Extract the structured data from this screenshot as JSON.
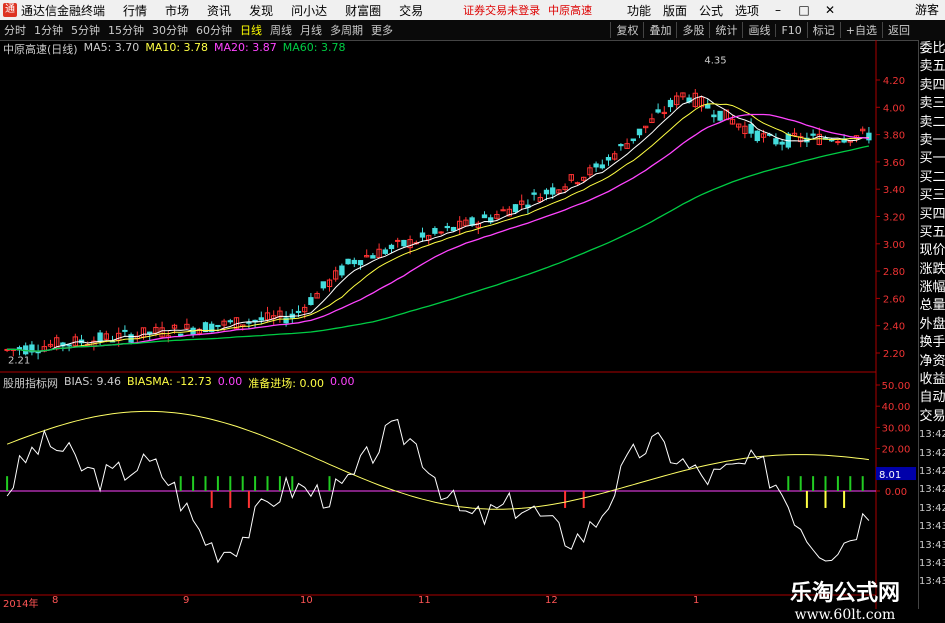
{
  "app": {
    "title": "通达信金融终端",
    "menu": [
      "行情",
      "市场",
      "资讯",
      "发现",
      "问小达",
      "财富圈",
      "交易"
    ],
    "notice": "证券交易未登录",
    "stock_name": "中原高速",
    "top_right": [
      "功能",
      "版面",
      "公式",
      "选项"
    ],
    "guest": "游客",
    "win_buttons": [
      "–",
      "□",
      "✕"
    ]
  },
  "toolbar": {
    "periods": [
      "分时",
      "1分钟",
      "5分钟",
      "15分钟",
      "30分钟",
      "60分钟",
      "日线",
      "周线",
      "月线",
      "多周期",
      "更多"
    ],
    "active_period": "日线",
    "tools": [
      "复权",
      "叠加",
      "多股",
      "统计",
      "画线",
      "F10",
      "标记",
      "+自选",
      "返回"
    ]
  },
  "main_panel": {
    "title": "中原高速(日线)",
    "ma5_label": "MA5: 3.70",
    "ma10_label": "MA10: 3.78",
    "ma20_label": "MA20: 3.87",
    "ma60_label": "MA60: 3.78",
    "high_label": "4.35",
    "low_label": "2.21",
    "y_ticks": [
      4.2,
      4.0,
      3.8,
      3.6,
      3.4,
      3.2,
      3.0,
      2.8,
      2.6,
      2.4,
      2.2
    ],
    "colors": {
      "ma5": "#ffffff",
      "ma10": "#ffff44",
      "ma20": "#ff44ff",
      "ma60": "#00cc44",
      "up": "#ff3333",
      "down": "#44dddd"
    }
  },
  "sub_panel": {
    "title": "股朋指标网",
    "bias_label": "BIAS: 9.46",
    "biasma_label": "BIASMA: -12.73",
    "extra_value": "0.00",
    "signal_label": "准备进场: 0.00",
    "signal_value2": "0.00",
    "y_ticks": [
      50.0,
      40.0,
      30.0,
      20.0,
      10.0,
      0.0
    ],
    "current_marker": "8.01"
  },
  "date_axis": {
    "year_label": "2014年",
    "months": [
      "8",
      "9",
      "10",
      "11",
      "12",
      "1"
    ]
  },
  "sidebar": {
    "items": [
      "委比",
      "卖五",
      "卖四",
      "卖三",
      "卖二",
      "卖一",
      "买一",
      "买二",
      "买三",
      "买四",
      "买五",
      "现价",
      "涨跌",
      "涨幅",
      "总量",
      "外盘",
      "换手",
      "净资",
      "收益",
      "自动",
      "交易",
      "13:42",
      "13:42",
      "13:42",
      "13:42",
      "13:42",
      "13:43",
      "13:43",
      "13:43",
      "13:43"
    ]
  },
  "watermark": {
    "line1": "乐淘公式网",
    "line2": "www.60lt.com"
  }
}
